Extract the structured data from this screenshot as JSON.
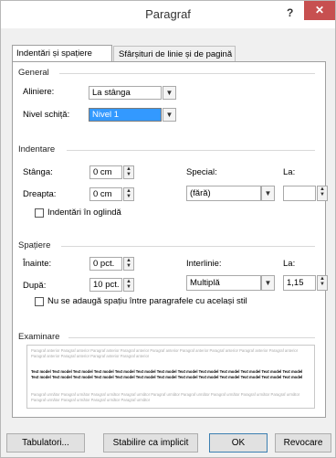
{
  "window": {
    "title": "Paragraf",
    "help_glyph": "?",
    "close_glyph": "✕"
  },
  "tabs": [
    {
      "label": "Indentări și spațiere"
    },
    {
      "label": "Sfârșituri de linie și de pagină"
    }
  ],
  "general": {
    "title": "General",
    "alignment_label": "Aliniere:",
    "alignment_value": "La stânga",
    "outline_label": "Nivel schiță:",
    "outline_value": "Nivel 1"
  },
  "indent": {
    "title": "Indentare",
    "left_label": "Stânga:",
    "left_value": "0 cm",
    "right_label": "Dreapta:",
    "right_value": "0 cm",
    "special_label": "Special:",
    "special_value": "(fără)",
    "by_label": "La:",
    "by_value": "",
    "mirror_label": "Indentări în oglindă"
  },
  "spacing": {
    "title": "Spațiere",
    "before_label": "Înainte:",
    "before_value": "0 pct.",
    "after_label": "După:",
    "after_value": "10 pct.",
    "line_label": "Interlinie:",
    "line_value": "Multiplă",
    "at_label": "La:",
    "at_value": "1,15",
    "dont_add_label": "Nu se adaugă spațiu între paragrafele cu același stil"
  },
  "preview": {
    "title": "Examinare",
    "previous": "Paragraf anterior Paragraf anterior Paragraf anterior Paragraf anterior Paragraf anterior Paragraf anterior Paragraf anterior Paragraf anterior Paragraf anterior Paragraf anterior Paragraf anterior Paragraf anterior Paragraf anterior",
    "sample": "Text model Text model Text model Text model Text model Text model Text model Text model Text model Text model Text model Text model Text model Text model Text model Text model Text model Text model Text model Text model Text model Text model Text model Text model Text model Text model",
    "following": "Paragraf următor Paragraf următor Paragraf următor Paragraf următor Paragraf următor Paragraf următor Paragraf următor Paragraf următor Paragraf următor Paragraf următor Paragraf următor Paragraf următor Paragraf următor"
  },
  "buttons": {
    "tabs": "Tabulatori...",
    "default": "Stabilire ca implicit",
    "ok": "OK",
    "cancel": "Revocare"
  }
}
